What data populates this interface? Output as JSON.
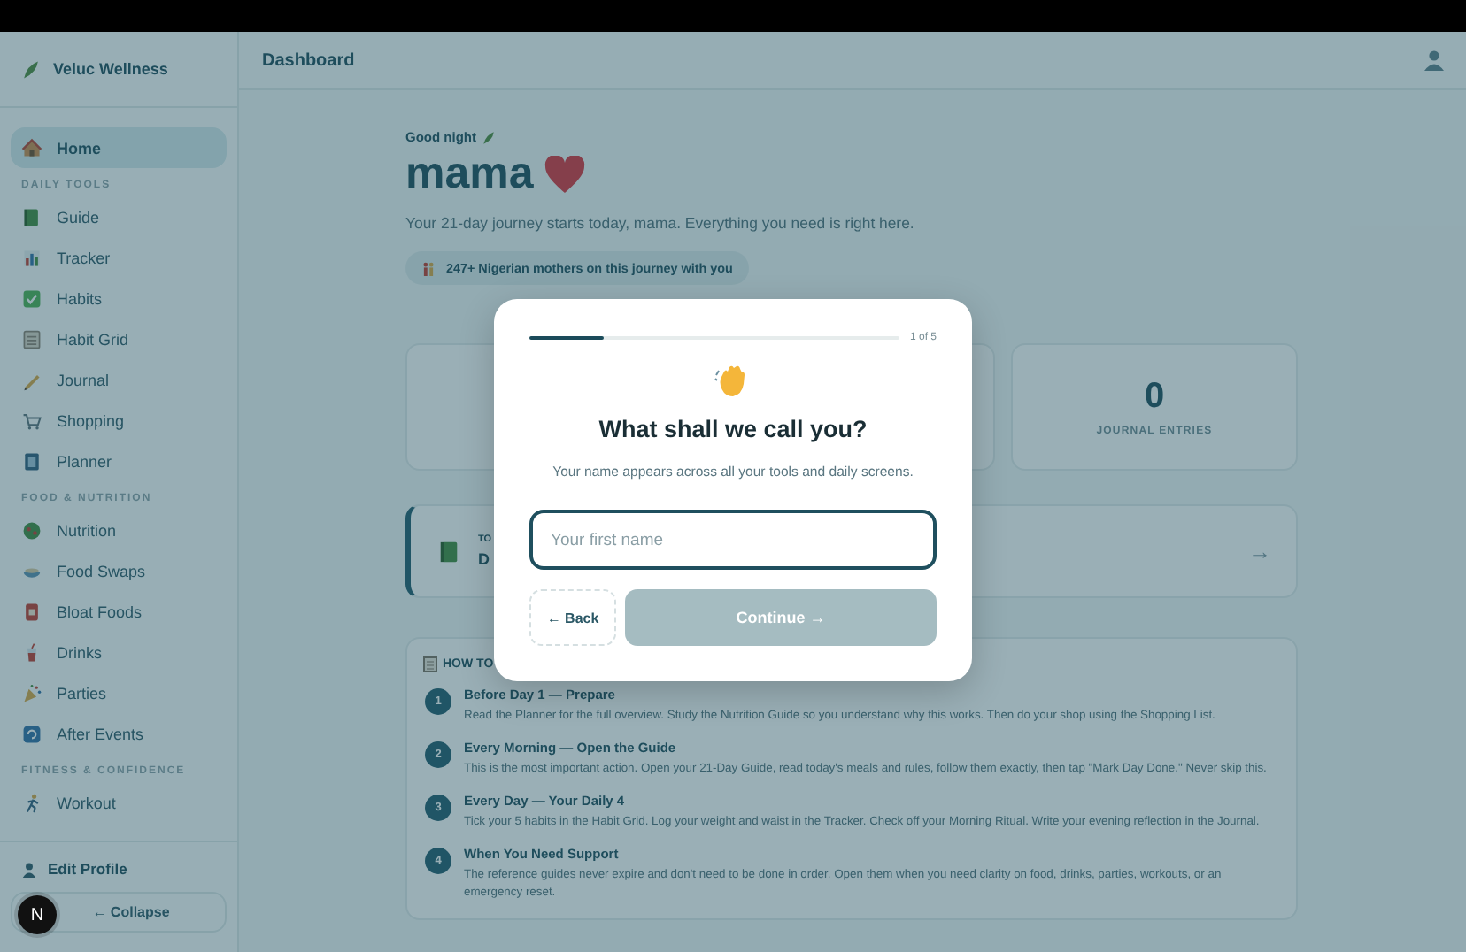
{
  "sidebar": {
    "brand": "Veluc Wellness",
    "sections": [
      {
        "items": [
          {
            "label": "Home",
            "selected": true
          }
        ]
      },
      {
        "title": "DAILY TOOLS",
        "items": [
          {
            "label": "Guide",
            "selected": false
          },
          {
            "label": "Tracker",
            "selected": false
          },
          {
            "label": "Habits",
            "selected": false
          },
          {
            "label": "Habit Grid",
            "selected": false
          },
          {
            "label": "Journal",
            "selected": false
          },
          {
            "label": "Shopping",
            "selected": false
          },
          {
            "label": "Planner",
            "selected": false
          }
        ]
      },
      {
        "title": "FOOD & NUTRITION",
        "items": [
          {
            "label": "Nutrition",
            "selected": false
          },
          {
            "label": "Food Swaps",
            "selected": false
          },
          {
            "label": "Bloat Foods",
            "selected": false
          },
          {
            "label": "Drinks",
            "selected": false
          },
          {
            "label": "Parties",
            "selected": false
          },
          {
            "label": "After Events",
            "selected": false
          }
        ]
      },
      {
        "title": "FITNESS & CONFIDENCE",
        "items": [
          {
            "label": "Workout",
            "selected": false
          }
        ]
      }
    ],
    "edit_profile": "Edit Profile",
    "collapse": "← Collapse"
  },
  "dev_badge": "N",
  "header": {
    "title": "Dashboard"
  },
  "welcome": {
    "greeting": "Good night",
    "name": "mama",
    "intro": "Your 21-day journey starts today, mama. Everything you need is right here.",
    "community": "247+ Nigerian mothers on this journey with you"
  },
  "stats": [
    {
      "kind": "covered"
    },
    {
      "kind": "covered"
    },
    {
      "kind": "value",
      "value": "0",
      "label": "JOURNAL ENTRIES"
    }
  ],
  "today_card": {
    "label": "TO",
    "title": "D",
    "arrow": "→"
  },
  "how_to": {
    "title": "HOW TO",
    "steps": [
      {
        "number": "1",
        "title": "Before Day 1 — Prepare",
        "text": "Read the Planner for the full overview. Study the Nutrition Guide so you understand why this works. Then do your shop using the Shopping List."
      },
      {
        "number": "2",
        "title": "Every Morning — Open the Guide",
        "text": "This is the most important action. Open your 21-Day Guide, read today's meals and rules, follow them exactly, then tap \"Mark Day Done.\" Never skip this."
      },
      {
        "number": "3",
        "title": "Every Day — Your Daily 4",
        "text": "Tick your 5 habits in the Habit Grid. Log your weight and waist in the Tracker. Check off your Morning Ritual. Write your evening reflection in the Journal."
      },
      {
        "number": "4",
        "title": "When You Need Support",
        "text": "The reference guides never expire and don't need to be done in order. Open them when you need clarity on food, drinks, parties, workouts, or an emergency reset."
      }
    ]
  },
  "modal": {
    "progress": {
      "level": 0.2
    },
    "step_counter": "1 of 5",
    "title": "What shall we call you?",
    "subtitle": "Your name appears across all your tools and daily screens.",
    "name_field": {
      "placeholder": "Your first name"
    },
    "back": "← Back",
    "continue": {
      "label": "Continue →",
      "disabled": true
    }
  }
}
